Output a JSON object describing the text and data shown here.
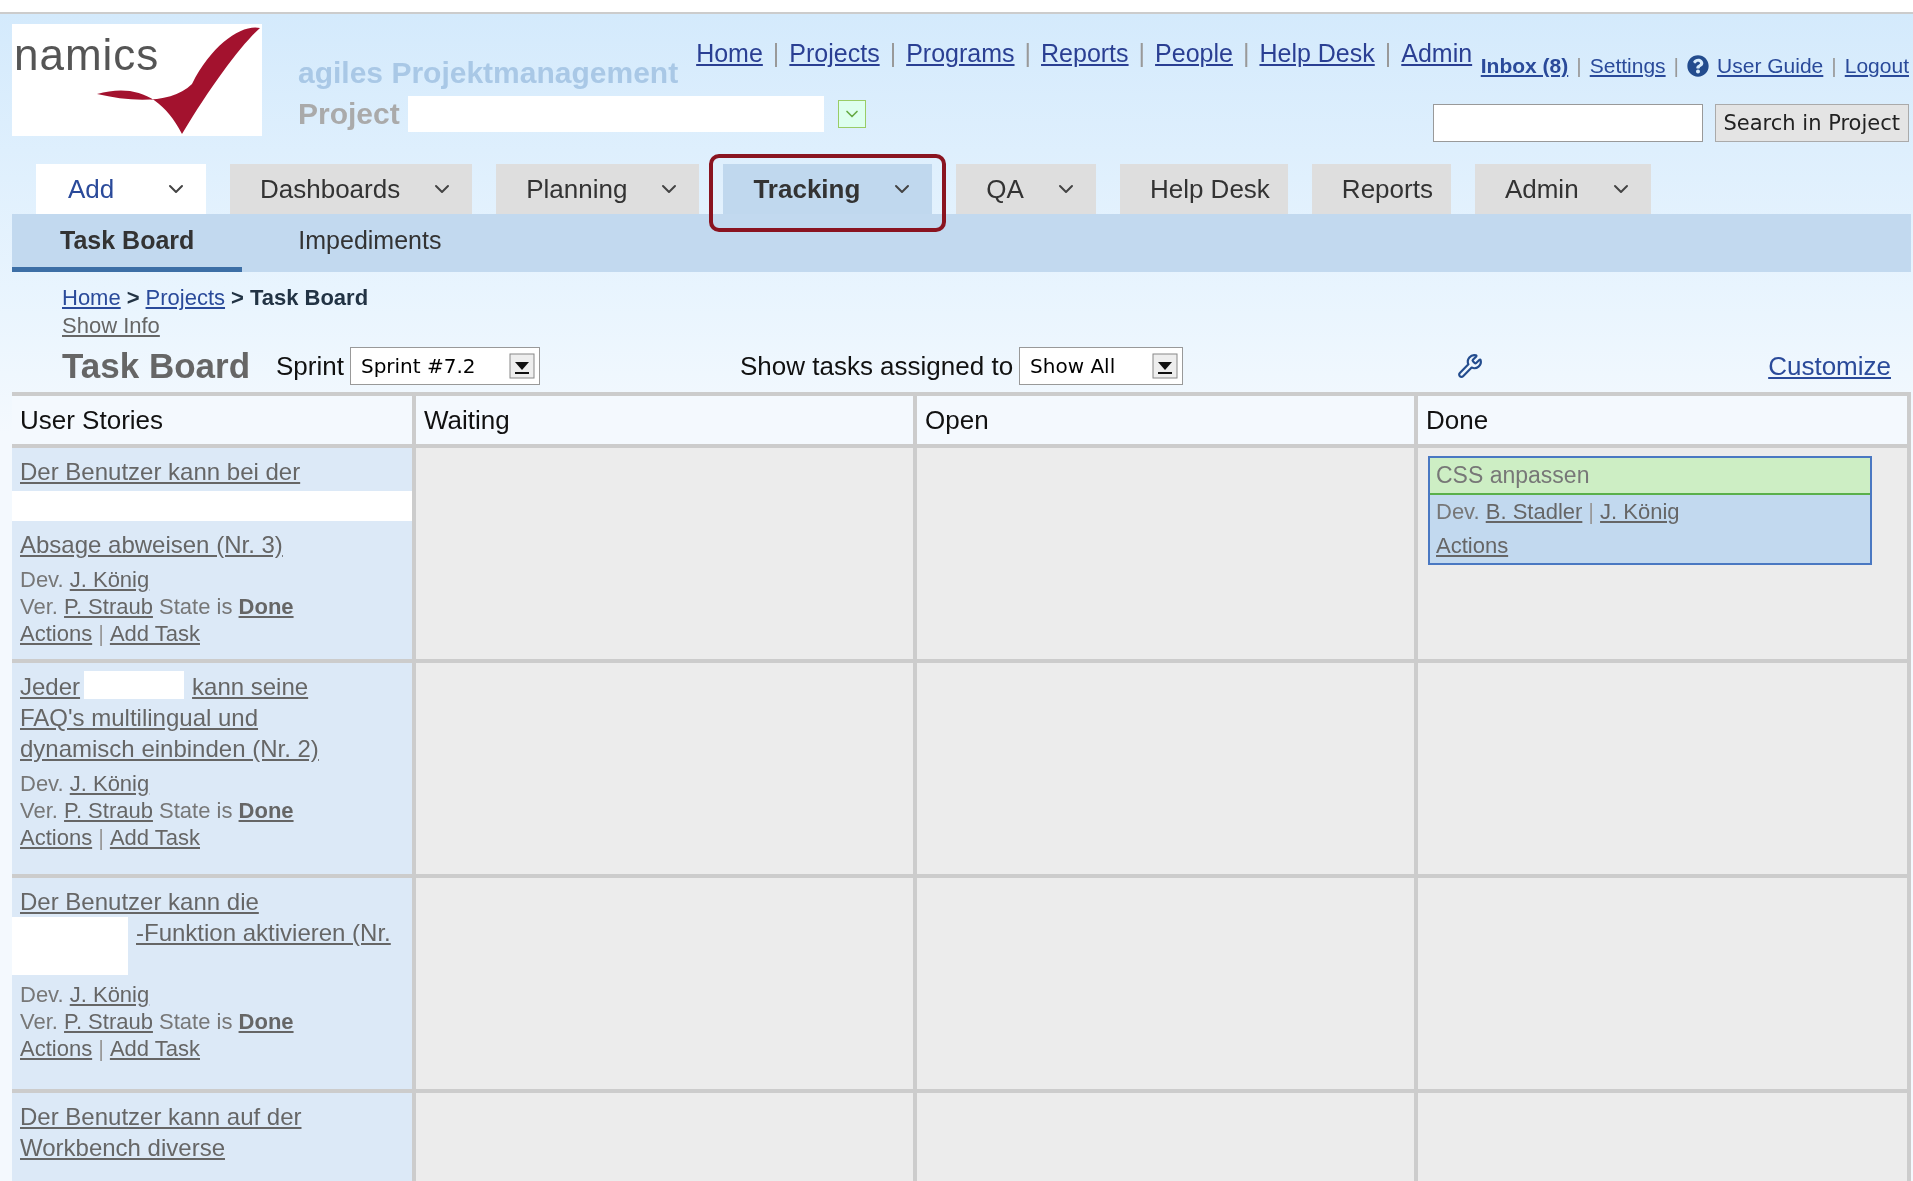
{
  "header": {
    "logo_text": "namics",
    "app_title": "agiles Projektmanagement",
    "project_label": "Project",
    "separator": "|",
    "nav_links": [
      "Home",
      "Projects",
      "Programs",
      "Reports",
      "People",
      "Help Desk",
      "Admin"
    ],
    "user_links": [
      {
        "label": "Inbox (8)",
        "bold": true,
        "help_icon": false
      },
      {
        "label": "Settings",
        "bold": false,
        "help_icon": false
      },
      {
        "label": "User Guide",
        "bold": false,
        "help_icon": true
      },
      {
        "label": "Logout",
        "bold": false,
        "help_icon": false
      }
    ],
    "search_button": "Search in Project"
  },
  "menu": [
    {
      "label": "Add",
      "kind": "add",
      "dropdown": true,
      "selected": false,
      "highlighted": false
    },
    {
      "label": "Dashboards",
      "kind": "menu",
      "dropdown": true,
      "selected": false,
      "highlighted": false
    },
    {
      "label": "Planning",
      "kind": "menu",
      "dropdown": true,
      "selected": false,
      "highlighted": false
    },
    {
      "label": "Tracking",
      "kind": "menu",
      "dropdown": true,
      "selected": true,
      "highlighted": true
    },
    {
      "label": "QA",
      "kind": "menu",
      "dropdown": true,
      "selected": false,
      "highlighted": false
    },
    {
      "label": "Help Desk",
      "kind": "menu",
      "dropdown": false,
      "selected": false,
      "highlighted": false
    },
    {
      "label": "Reports",
      "kind": "menu",
      "dropdown": false,
      "selected": false,
      "highlighted": false
    },
    {
      "label": "Admin",
      "kind": "menu",
      "dropdown": true,
      "selected": false,
      "highlighted": false
    }
  ],
  "subtabs": [
    {
      "label": "Task Board",
      "selected": true
    },
    {
      "label": "Impediments",
      "selected": false
    }
  ],
  "breadcrumb": {
    "links": [
      "Home",
      "Projects"
    ],
    "current": "Task Board",
    "separator": ">"
  },
  "show_info": "Show Info",
  "toolbar": {
    "title": "Task Board",
    "sprint_label": "Sprint",
    "sprint_value": "Sprint #7.2",
    "assigned_label": "Show tasks assigned to",
    "assigned_value": "Show All",
    "customize": "Customize"
  },
  "board": {
    "columns": [
      "User Stories",
      "Waiting",
      "Open",
      "Done"
    ],
    "separator": "|",
    "rows": [
      {
        "cells": [
          {
            "parts": [
              {
                "kind": "line",
                "text": "Der Benutzer kann bei der"
              },
              {
                "kind": "redacted_line"
              },
              {
                "kind": "line",
                "text": "Absage abweisen (Nr. 3)"
              }
            ],
            "dev_label": "Dev.",
            "dev": "J. König",
            "ver_label": "Ver.",
            "verifier": "P. Straub",
            "state_label": "State is",
            "state": "Done",
            "actions": "Actions",
            "add_task": "Add Task"
          },
          "",
          "",
          {
            "tasks": [
              {
                "title": "CSS anpassen",
                "dev_label": "Dev.",
                "devs": [
                  "B. Stadler",
                  "J. König"
                ],
                "actions": "Actions"
              }
            ]
          }
        ]
      },
      {
        "cells": [
          {
            "parts": [
              {
                "kind": "text",
                "text": "Jeder"
              },
              {
                "kind": "redacted_word"
              },
              {
                "kind": "text",
                "text": "kann seine"
              },
              {
                "kind": "line",
                "text": "FAQ's multilingual und"
              },
              {
                "kind": "line",
                "text": "dynamisch einbinden (Nr. 2)"
              }
            ],
            "dev_label": "Dev.",
            "dev": "J. König",
            "ver_label": "Ver.",
            "verifier": "P. Straub",
            "state_label": "State is",
            "state": "Done",
            "actions": "Actions",
            "add_task": "Add Task"
          },
          "",
          "",
          ""
        ]
      },
      {
        "cells": [
          {
            "parts": [
              {
                "kind": "line",
                "text": "Der Benutzer kann die"
              },
              {
                "kind": "redacted_block"
              },
              {
                "kind": "text",
                "text": "-Funktion aktivieren (Nr."
              }
            ],
            "dev_label": "Dev.",
            "dev": "J. König",
            "ver_label": "Ver.",
            "verifier": "P. Straub",
            "state_label": "State is",
            "state": "Done",
            "actions": "Actions",
            "add_task": "Add Task"
          },
          "",
          "",
          ""
        ]
      },
      {
        "cells": [
          {
            "parts": [
              {
                "kind": "line",
                "text": "Der Benutzer kann auf der"
              },
              {
                "kind": "line",
                "text": "Workbench diverse"
              }
            ]
          },
          "",
          "",
          ""
        ]
      }
    ]
  }
}
